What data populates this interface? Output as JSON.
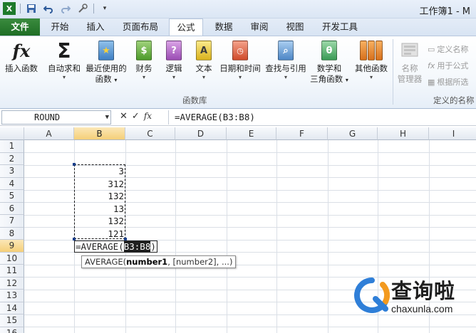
{
  "window": {
    "title": "工作簿1 - M"
  },
  "qat": {
    "save_icon": "save-icon",
    "undo_icon": "undo-icon",
    "redo_icon": "redo-icon",
    "customize_icon": "customize-icon"
  },
  "tabs": [
    "文件",
    "开始",
    "插入",
    "页面布局",
    "公式",
    "数据",
    "审阅",
    "视图",
    "开发工具"
  ],
  "active_tab": "公式",
  "ribbon": {
    "insert_function": "插入函数",
    "autosum": "自动求和",
    "recent": [
      "最近使用的",
      "函数"
    ],
    "financial": "财务",
    "logical": "逻辑",
    "text": "文本",
    "datetime": "日期和时间",
    "lookup": "查找与引用",
    "math": [
      "数学和",
      "三角函数"
    ],
    "more": "其他函数",
    "group_library": "函数库",
    "name_manager": [
      "名称",
      "管理器"
    ],
    "define_name": "定义名称",
    "use_in_formula": "用于公式",
    "create_from_sel": "根据所选",
    "group_defined": "定义的名称",
    "caret": "▾"
  },
  "formula_bar": {
    "name_box": "ROUND",
    "cancel": "✕",
    "enter": "✓",
    "fx": "fx",
    "formula": "=AVERAGE(B3:B8)"
  },
  "columns": [
    "A",
    "B",
    "C",
    "D",
    "E",
    "F",
    "G",
    "H",
    "I"
  ],
  "rows": [
    "1",
    "2",
    "3",
    "4",
    "5",
    "6",
    "7",
    "8",
    "9",
    "10",
    "11",
    "12",
    "13",
    "14",
    "15",
    "16"
  ],
  "cells_b": [
    "3",
    "312",
    "132",
    "13",
    "132",
    "121"
  ],
  "edit": {
    "prefix": "=AVERAGE(",
    "range": "B3:B8",
    "suffix": ")"
  },
  "tooltip": {
    "fn": "AVERAGE(",
    "arg1": "number1",
    "rest": ", [number2], ...)"
  },
  "watermark": {
    "brand": "查询啦",
    "url": "chaxunla.com"
  },
  "colors": {
    "file_tab": "#2a7d2f",
    "selected_header": "#f5cf78",
    "watermark_blue": "#2f7fd8",
    "watermark_orange": "#f39a1f"
  }
}
